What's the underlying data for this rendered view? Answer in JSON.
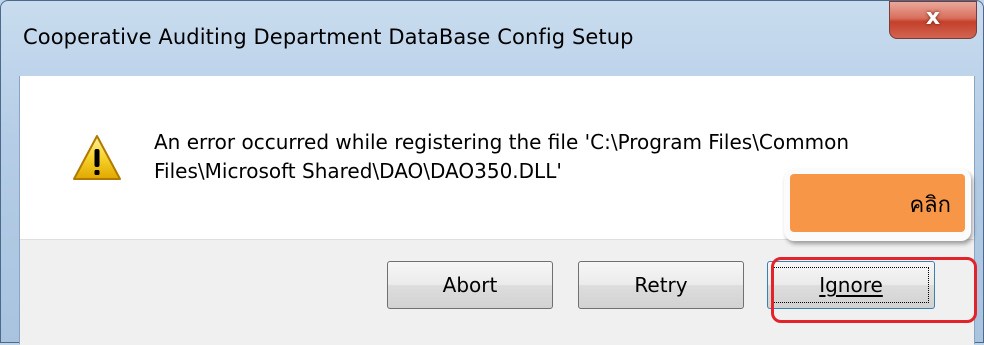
{
  "window": {
    "title": "Cooperative Auditing Department DataBase Config Setup",
    "close_label": "x"
  },
  "dialog": {
    "icon": "warning-icon",
    "message_line1": "An error occurred while registering the file 'C:\\Program Files\\Common",
    "message_line2": "Files\\Microsoft Shared\\DAO\\DAO350.DLL'"
  },
  "buttons": {
    "abort_label": "Abort",
    "retry_label": "Retry",
    "ignore_label": "Ignore"
  },
  "annotation": {
    "callout_text": "คลิก",
    "callout_color": "#f79646",
    "highlight_color": "#e2232a"
  }
}
